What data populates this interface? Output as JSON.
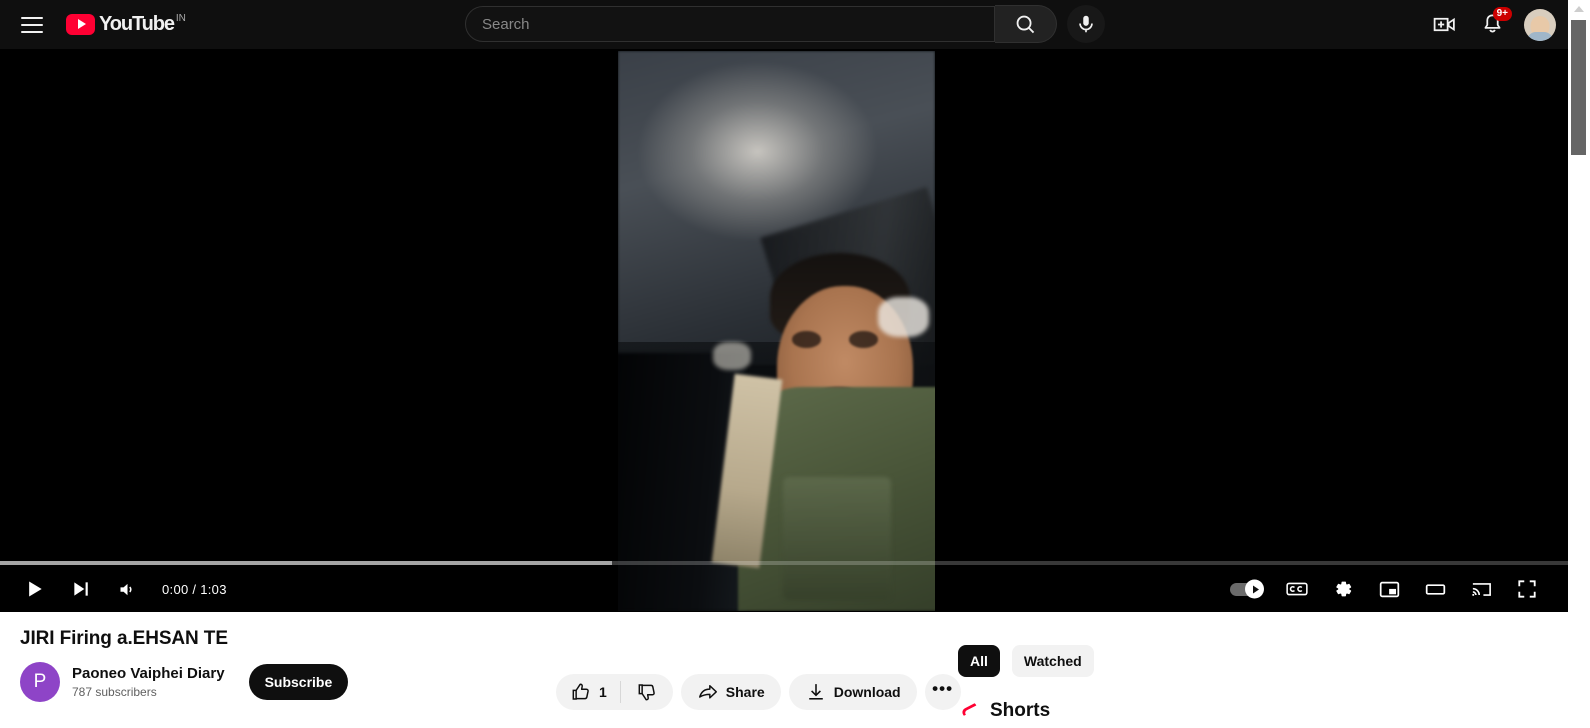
{
  "masthead": {
    "guide_icon": "hamburger-menu-icon",
    "logo_text": "YouTube",
    "country_code": "IN",
    "search": {
      "placeholder": "Search",
      "value": "",
      "search_icon": "search-icon",
      "voice_icon": "microphone-icon"
    },
    "create_icon": "create-video-icon",
    "notifications_icon": "bell-icon",
    "notifications_badge": "9+",
    "avatar_icon": "account-avatar"
  },
  "player": {
    "current_time": "0:00",
    "duration": "1:03",
    "time_display": "0:00 / 1:03",
    "progress_percent": 0,
    "buffered_percent": 39,
    "play_icon": "play-icon",
    "next_icon": "next-video-icon",
    "volume_icon": "volume-icon",
    "autoplay_icon": "autoplay-toggle-on",
    "subtitles_icon": "closed-captions-icon",
    "settings_icon": "gear-icon",
    "miniplayer_icon": "miniplayer-icon",
    "theater_icon": "theater-mode-icon",
    "cast_icon": "cast-icon",
    "fullscreen_icon": "fullscreen-icon"
  },
  "video": {
    "title": "JIRI Firing a.EHSAN TE",
    "channel": {
      "avatar_letter": "P",
      "avatar_color": "#8e44c7",
      "name": "Paoneo Vaiphei Diary",
      "subscribers": "787 subscribers",
      "subscribe_label": "Subscribe"
    },
    "actions": {
      "like_icon": "thumbs-up-icon",
      "like_count": "1",
      "dislike_icon": "thumbs-down-icon",
      "share_icon": "share-icon",
      "share_label": "Share",
      "download_icon": "download-icon",
      "download_label": "Download",
      "more_label": "•••"
    }
  },
  "sidebar": {
    "chips": [
      {
        "label": "All",
        "selected": true
      },
      {
        "label": "Watched",
        "selected": false
      }
    ],
    "shorts_section": {
      "icon": "shorts-logo-icon",
      "title": "Shorts"
    }
  },
  "scrollbar": {
    "up_arrow_icon": "scroll-up-arrow-icon",
    "thumb": "scroll-thumb"
  },
  "colors": {
    "brand_red": "#ff0033",
    "header_bg": "#0f0f0f",
    "player_bg": "#000000",
    "page_bg": "#ffffff",
    "badge_red": "#cc0000",
    "channel_avatar": "#8e44c7"
  }
}
